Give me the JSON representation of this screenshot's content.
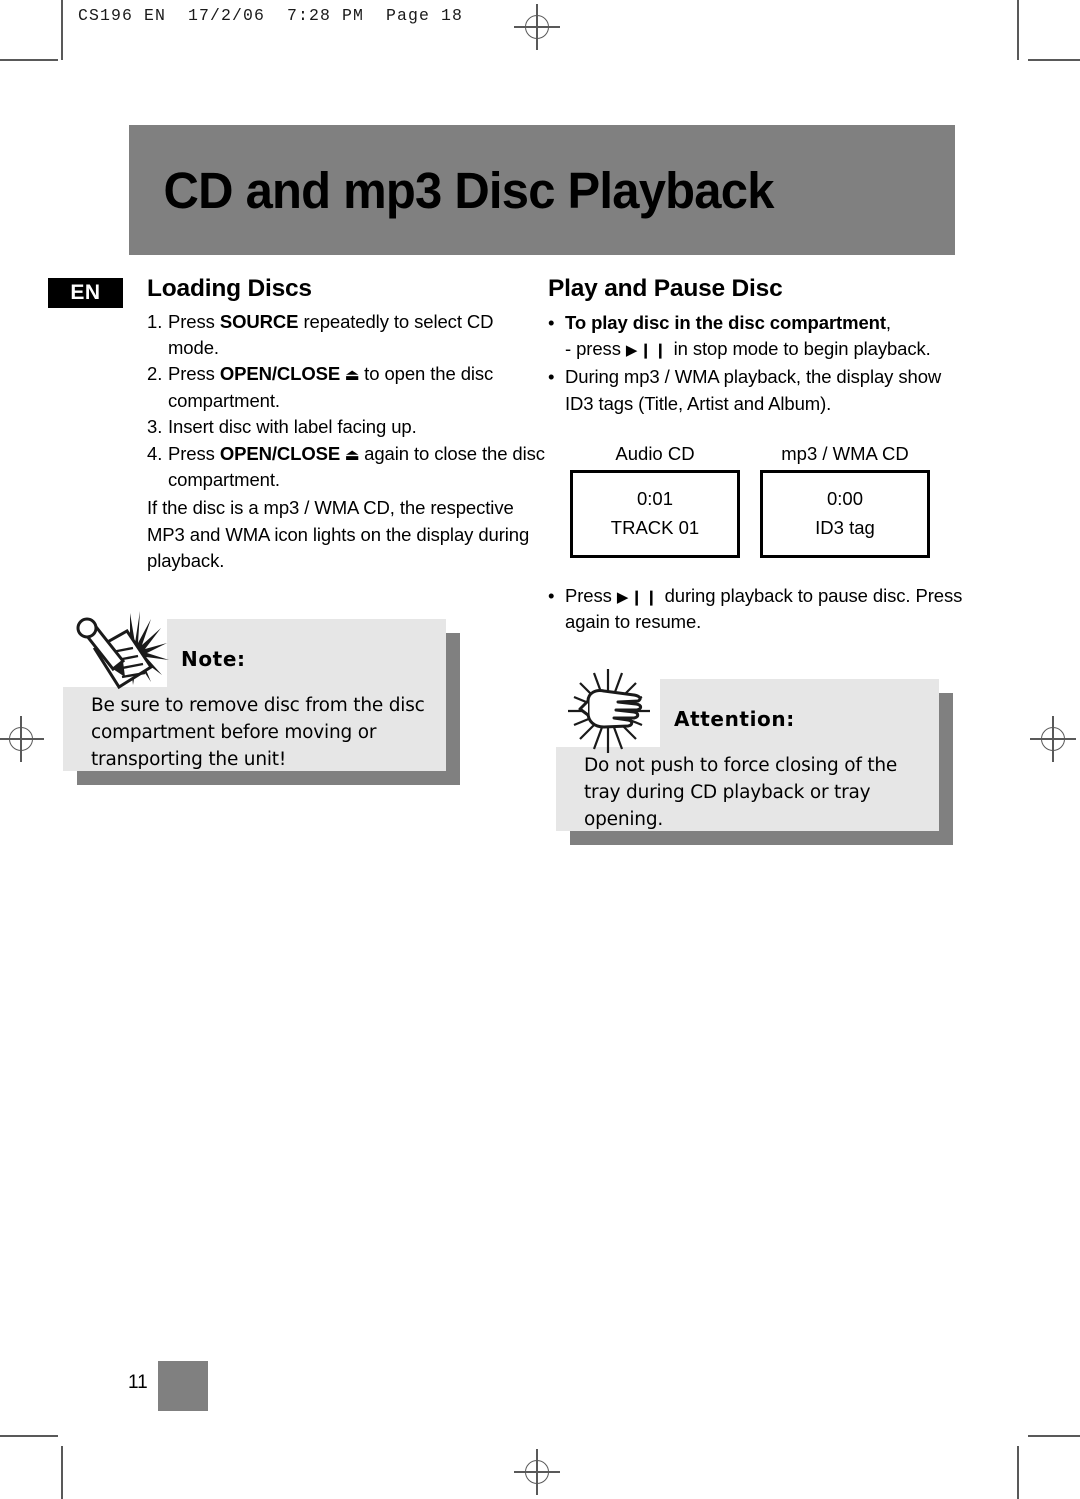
{
  "prepress": {
    "slug": "CS196 EN  17/2/06  7:28 PM  Page 18"
  },
  "banner": {
    "title": "CD and mp3 Disc Playback",
    "bg_color": "#808080"
  },
  "left_column": {
    "language_badge": "EN",
    "heading": "Loading Discs",
    "steps": [
      {
        "num": "1.",
        "parts": [
          {
            "text": "Press ",
            "bold": false
          },
          {
            "text": "SOURCE",
            "bold": true
          },
          {
            "text": "  repeatedly to select CD mode.",
            "bold": false
          }
        ]
      },
      {
        "num": "2.",
        "parts": [
          {
            "text": "Press ",
            "bold": false
          },
          {
            "text": "OPEN/CLOSE",
            "bold": true
          },
          {
            "text": "  ⏏ ",
            "bold": false,
            "glyph": true
          },
          {
            "text": " to open the disc compartment.",
            "bold": false
          }
        ]
      },
      {
        "num": "3.",
        "parts": [
          {
            "text": "Insert disc with label facing up.",
            "bold": false
          }
        ]
      },
      {
        "num": "4.",
        "parts": [
          {
            "text": "Press ",
            "bold": false
          },
          {
            "text": "OPEN/CLOSE",
            "bold": true
          },
          {
            "text": "  ⏏ ",
            "bold": false,
            "glyph": true
          },
          {
            "text": " again to close the disc compartment.",
            "bold": false
          }
        ]
      }
    ],
    "paragraph": "If the disc is a mp3 / WMA CD, the respective MP3 and WMA icon lights on the display during playback.",
    "note_box": {
      "icon": "note-pencil-icon",
      "title": "Note:",
      "body": "Be sure to remove disc from the disc compartment before moving or transporting the unit!",
      "bg_color": "#e6e6e6",
      "shadow_color": "#808080"
    }
  },
  "right_column": {
    "heading": "Play and Pause Disc",
    "bullets": [
      {
        "bold_lead": "To play disc in the disc compartment",
        "lead_suffix": ",",
        "sub_prefix": "- press ",
        "glyph": "▶❙❙",
        "sub_suffix": " in stop mode to begin playback."
      },
      {
        "text": "During mp3 / WMA playback, the display show ID3 tags (Title, Artist and Album)."
      }
    ],
    "displays": [
      {
        "caption": "Audio CD",
        "line1": "0:01",
        "line2": "TRACK 01"
      },
      {
        "caption": "mp3 / WMA CD",
        "line1": "0:00",
        "line2": "ID3 tag"
      }
    ],
    "bullet_pause": {
      "prefix": "Press ",
      "glyph": "▶❙❙",
      "suffix": " during playback to pause disc. Press again to resume."
    },
    "attention_box": {
      "icon": "pointing-hand-icon",
      "title": "Attention:",
      "body": "Do not push to force closing of the tray during CD playback or tray opening.",
      "bg_color": "#e6e6e6",
      "shadow_color": "#808080"
    }
  },
  "footer": {
    "page_number": "11",
    "marker_color": "#808080"
  }
}
